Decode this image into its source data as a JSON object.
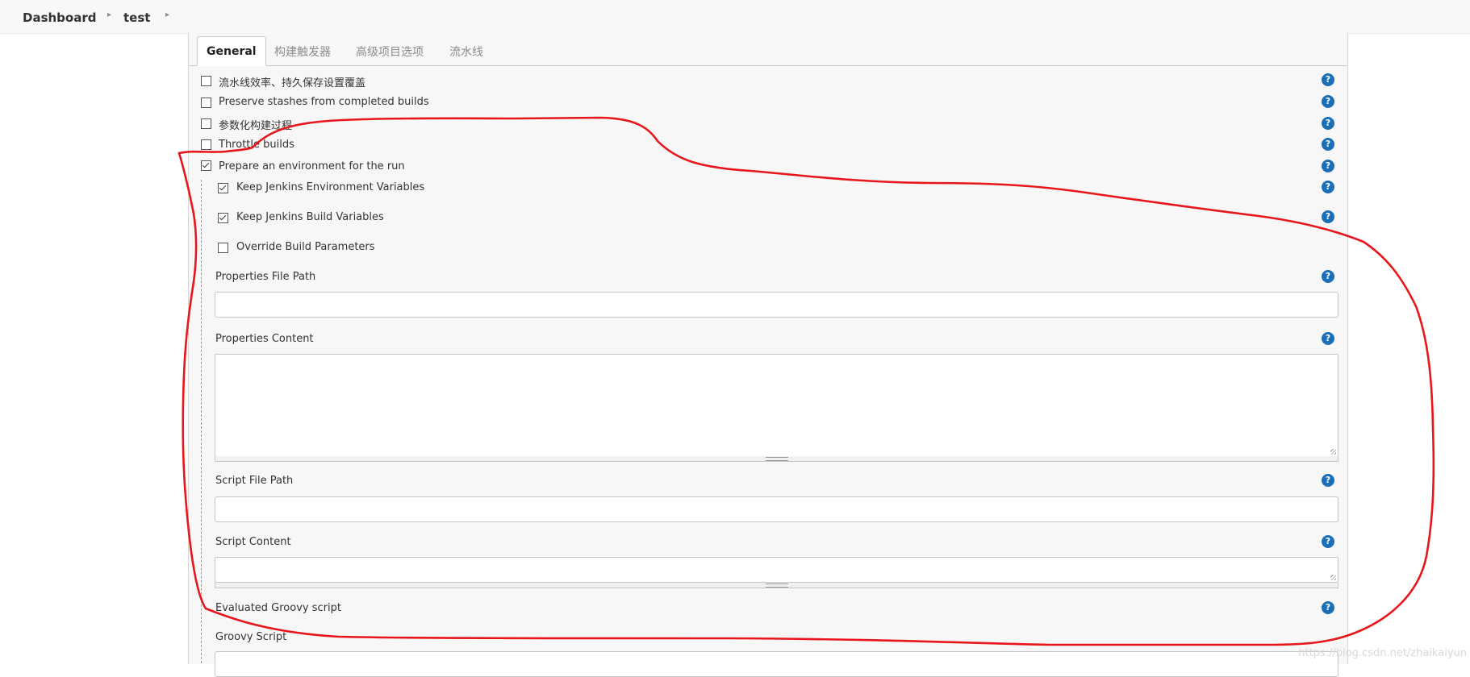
{
  "breadcrumb": {
    "items": [
      "Dashboard",
      "test"
    ]
  },
  "tabs": [
    "General",
    "构建触发器",
    "高级项目选项",
    "流水线"
  ],
  "options": [
    {
      "label": "流水线效率、持久保存设置覆盖",
      "checked": false
    },
    {
      "label": "Preserve stashes from completed builds",
      "checked": false
    },
    {
      "label": "参数化构建过程",
      "checked": false
    },
    {
      "label": "Throttle builds",
      "checked": false
    },
    {
      "label": "Prepare an environment for the run",
      "checked": true
    }
  ],
  "env": {
    "keep_env_vars": {
      "label": "Keep Jenkins Environment Variables",
      "checked": true
    },
    "keep_build_vars": {
      "label": "Keep Jenkins Build Variables",
      "checked": true
    },
    "override_params": {
      "label": "Override Build Parameters",
      "checked": false
    },
    "properties_file_path": {
      "label": "Properties File Path",
      "value": ""
    },
    "properties_content": {
      "label": "Properties Content",
      "value": ""
    },
    "script_file_path": {
      "label": "Script File Path",
      "value": ""
    },
    "script_content": {
      "label": "Script Content",
      "value": ""
    },
    "evaluated_groovy": {
      "label": "Evaluated Groovy script"
    },
    "groovy_script": {
      "label": "Groovy Script"
    }
  },
  "help_glyph": "?",
  "watermark": "https://blog.csdn.net/zhaikaiyun",
  "colors": {
    "annotation": "#e8161b",
    "help": "#1a6fb7"
  }
}
